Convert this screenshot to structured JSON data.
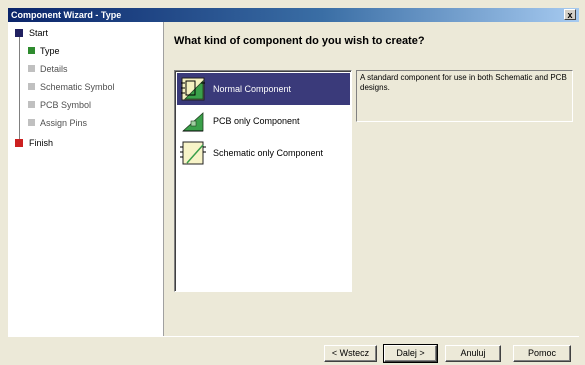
{
  "window": {
    "title": "Component Wizard - Type",
    "close_label": "x"
  },
  "steps": [
    {
      "label": "Start",
      "color": "#202060",
      "level": "top"
    },
    {
      "label": "Type",
      "color": "#2e8b2e",
      "level": "sub",
      "current": true
    },
    {
      "label": "Details",
      "color": "#c0c0c0",
      "level": "sub"
    },
    {
      "label": "Schematic Symbol",
      "color": "#c0c0c0",
      "level": "sub"
    },
    {
      "label": "PCB Symbol",
      "color": "#c0c0c0",
      "level": "sub"
    },
    {
      "label": "Assign Pins",
      "color": "#c0c0c0",
      "level": "sub"
    },
    {
      "label": "Finish",
      "color": "#cc2020",
      "level": "top"
    }
  ],
  "main": {
    "heading": "What kind of component do you wish to create?",
    "components": [
      {
        "label": "Normal Component",
        "icon": "normal-component-icon",
        "selected": true
      },
      {
        "label": "PCB only Component",
        "icon": "pcb-component-icon",
        "selected": false
      },
      {
        "label": "Schematic only Component",
        "icon": "schematic-component-icon",
        "selected": false
      }
    ],
    "description": "A standard component for use in both Schematic and PCB designs."
  },
  "buttons": {
    "back": "< Wstecz",
    "next": "Dalej >",
    "cancel": "Anuluj",
    "help": "Pomoc"
  }
}
